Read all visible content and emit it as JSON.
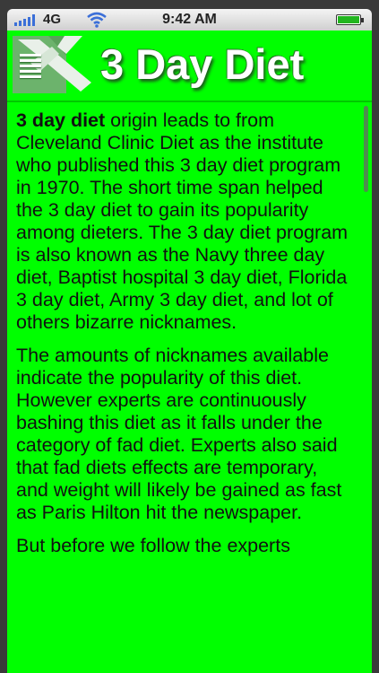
{
  "status_bar": {
    "carrier": "4G",
    "time": "9:42 AM",
    "icons": [
      "signal-bars-icon",
      "wifi-icon",
      "battery-icon"
    ]
  },
  "header": {
    "title": "3 Day Diet",
    "icons": [
      "menu-icon",
      "arrow-logo-icon"
    ]
  },
  "article": {
    "p1_bold": "3 day diet",
    "p1_rest": " origin leads to from Cleveland Clinic Diet as the institute who published this 3 day diet program in 1970. The short time span helped the 3 day diet to gain its popularity among dieters. The 3 day diet program is also known as the Navy three day diet, Baptist hospital 3 day diet, Florida 3 day diet, Army 3 day diet, and lot of others bizarre nicknames.",
    "p2": "The amounts of nicknames available indicate the popularity of this diet. However experts are continuously bashing this diet as it falls under the category of fad diet. Experts also said that fad diets effects are temporary, and weight will likely be gained as fast as Paris Hilton hit the newspaper.",
    "p3": "But before we follow the experts"
  },
  "colors": {
    "background": "#00ff00",
    "title_text": "#ffffff",
    "body_text": "#111111"
  }
}
